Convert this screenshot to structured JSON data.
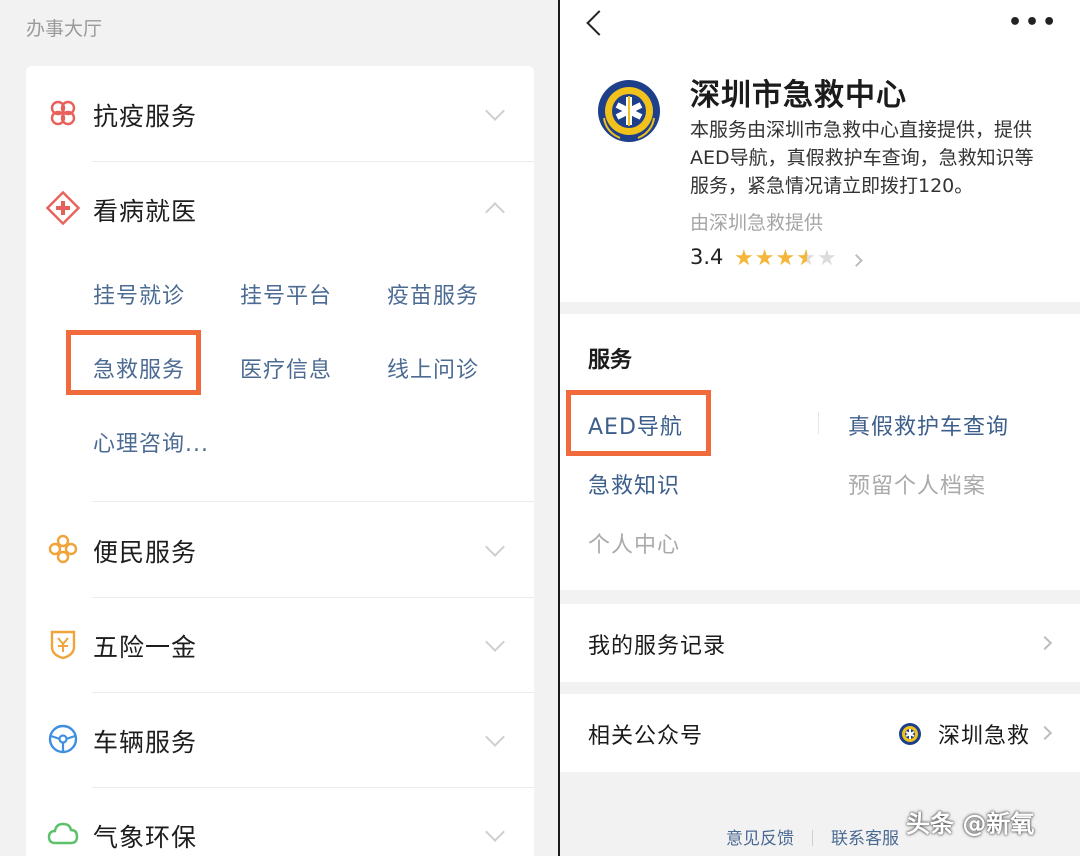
{
  "left": {
    "header": "办事大厅",
    "categories": [
      {
        "label": "抗疫服务"
      },
      {
        "label": "看病就医"
      },
      {
        "label": "便民服务"
      },
      {
        "label": "五险一金"
      },
      {
        "label": "车辆服务"
      },
      {
        "label": "气象环保"
      }
    ],
    "medical_items": [
      "挂号就诊",
      "挂号平台",
      "疫苗服务",
      "急救服务",
      "医疗信息",
      "线上问诊",
      "心理咨询..."
    ]
  },
  "right": {
    "title": "深圳市急救中心",
    "description": "本服务由深圳市急救中心直接提供，提供AED导航，真假救护车查询，急救知识等服务，紧急情况请立即拨打120。",
    "provider": "由深圳急救提供",
    "rating": "3.4",
    "rating_value": 3.4,
    "section_title": "服务",
    "services": [
      "AED导航",
      "真假救护车查询",
      "急救知识",
      "预留个人档案",
      "个人中心"
    ],
    "records_label": "我的服务记录",
    "official_label": "相关公众号",
    "official_account": "深圳急救",
    "footer_feedback": "意见反馈",
    "footer_contact": "联系客服"
  },
  "watermark": "头条 @新氧",
  "colors": {
    "highlight": "#f06a3b",
    "link": "#4c6b93",
    "star": "#f4b73b"
  }
}
